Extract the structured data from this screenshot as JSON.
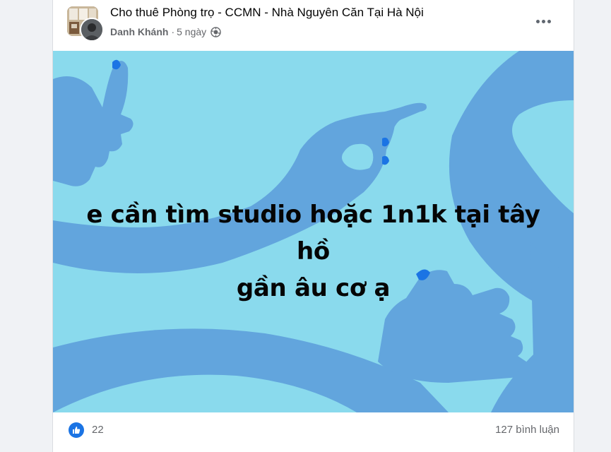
{
  "post": {
    "group_name": "Cho thuê Phòng trọ - CCMN - Nhà Nguyên Căn Tại Hà Nội",
    "author": "Danh Khánh",
    "separator": "·",
    "time": "5 ngày",
    "privacy_icon": "globe-icon",
    "more_icon": "more-options-icon",
    "text_line1": "e cần tìm studio hoặc 1n1k tại tây hồ",
    "text_line2": "gần âu cơ ạ",
    "background_color": "#8adaed",
    "hand_color": "#62a5dd",
    "nail_color": "#1b74e4"
  },
  "footer": {
    "reaction_icon": "like-icon",
    "reaction_count": "22",
    "comment_count": "127 bình luận"
  }
}
